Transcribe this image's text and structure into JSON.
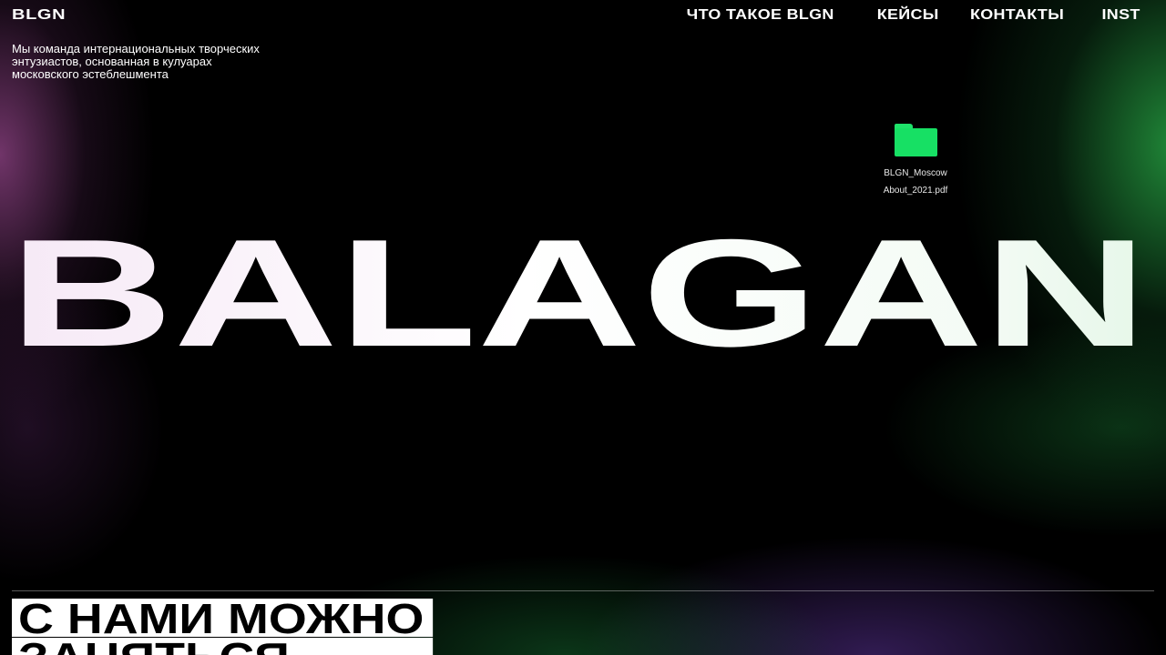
{
  "header": {
    "logo": "BLGN",
    "nav": [
      {
        "label": "ЧТО ТАКОЕ BLGN"
      },
      {
        "label": "КЕЙСЫ"
      },
      {
        "label": "КОНТАКТЫ"
      },
      {
        "label": "INST"
      }
    ]
  },
  "intro": {
    "tagline_lines": [
      "Мы команда интернациональных творческих",
      "энтузиастов, основанная в кулуарах",
      "московского эстеблешмента"
    ]
  },
  "download": {
    "icon": "folder-icon",
    "icon_color": "#17e064",
    "name_lines": [
      "BLGN_Moscow",
      "About_2021.pdf"
    ]
  },
  "hero": {
    "title": "BALAGAN"
  },
  "section": {
    "heading_lines": [
      "С НАМИ МОЖНО",
      "ЗАНЯТЬСЯ"
    ]
  },
  "colors": {
    "background": "#000000",
    "accent_green": "#17e064",
    "glow_purple": "#96468c"
  }
}
